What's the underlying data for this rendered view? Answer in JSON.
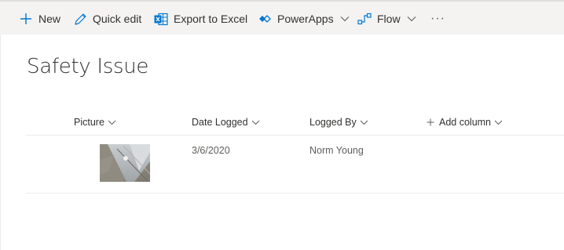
{
  "commandbar": {
    "new_label": "New",
    "quick_edit_label": "Quick edit",
    "export_label": "Export to Excel",
    "powerapps_label": "PowerApps",
    "flow_label": "Flow",
    "more_label": "···"
  },
  "icons": {
    "new": "plus-icon",
    "quick_edit": "pencil-icon",
    "export": "excel-icon",
    "powerapps": "powerapps-icon",
    "flow": "flow-icon",
    "chevron": "chevron-down-icon"
  },
  "colors": {
    "accent": "#0078d4",
    "commandbar_bg": "#f4f3f2",
    "text": "#323130",
    "subtext": "#605e5c",
    "divider": "#edebe9"
  },
  "page": {
    "title": "Safety Issue"
  },
  "columns": {
    "picture": "Picture",
    "date_logged": "Date Logged",
    "logged_by": "Logged By",
    "add_column": "Add column"
  },
  "rows": [
    {
      "date_logged": "3/6/2020",
      "logged_by": "Norm Young"
    }
  ]
}
